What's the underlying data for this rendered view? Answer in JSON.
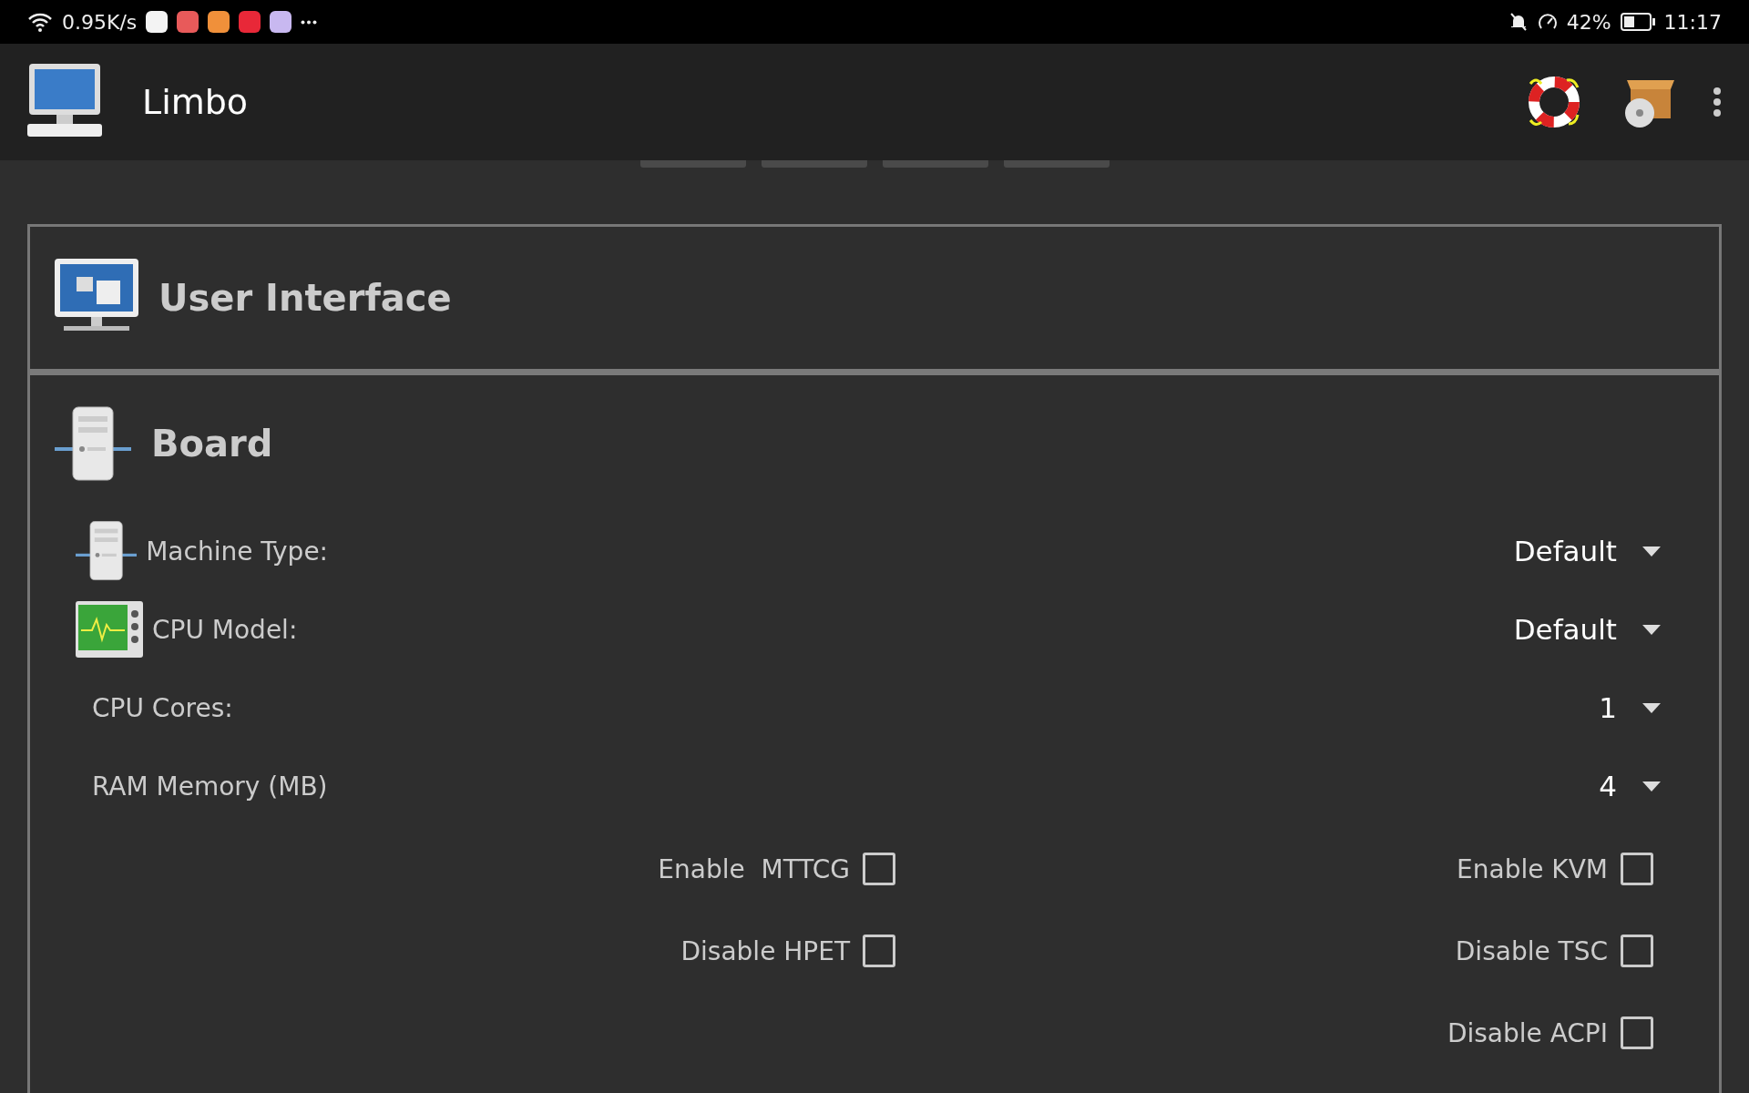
{
  "status_bar": {
    "net_speed": "0.95K/s",
    "battery_text": "42%",
    "time": "11:17"
  },
  "app_bar": {
    "title": "Limbo"
  },
  "sections": [
    {
      "title": "User Interface",
      "kind": "display"
    },
    {
      "title": "Board",
      "kind": "board"
    }
  ],
  "board": {
    "dropdowns": [
      {
        "label": "Machine Type:",
        "value": "Default",
        "kind": "machine"
      },
      {
        "label": "CPU Model:",
        "value": "Default",
        "kind": "cpu"
      },
      {
        "label": "CPU Cores:",
        "value": "1",
        "kind": "plain"
      },
      {
        "label": "RAM Memory (MB)",
        "value": "4",
        "kind": "plain"
      }
    ],
    "checkbox_rows": [
      {
        "left": {
          "label": "Enable  MTTCG",
          "checked": false
        },
        "right": {
          "label": "Enable KVM",
          "checked": false
        }
      },
      {
        "left": {
          "label": "Disable HPET",
          "checked": false
        },
        "right": {
          "label": "Disable TSC",
          "checked": false
        }
      },
      {
        "right": {
          "label": "Disable ACPI",
          "checked": false
        }
      }
    ]
  }
}
